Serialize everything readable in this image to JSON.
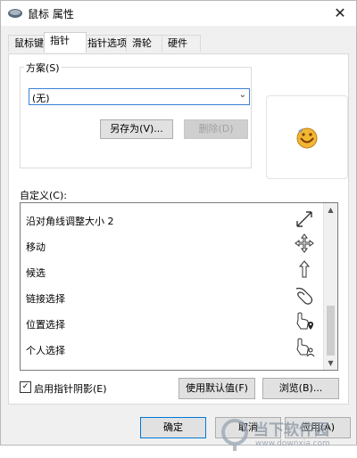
{
  "window": {
    "title": "鼠标 属性",
    "close_glyph": "✕"
  },
  "tabs": [
    {
      "label": "鼠标键",
      "active": false
    },
    {
      "label": "指针",
      "active": true
    },
    {
      "label": "指针选项",
      "active": false
    },
    {
      "label": "滑轮",
      "active": false
    },
    {
      "label": "硬件",
      "active": false
    }
  ],
  "scheme": {
    "group_label": "方案(S)",
    "selected": "(无)",
    "save_as_label": "另存为(V)...",
    "delete_label": "删除(D)"
  },
  "custom": {
    "label": "自定义(C):",
    "items": [
      {
        "label": "沿对角线调整大小 2",
        "icon": "diagonal-resize-icon"
      },
      {
        "label": "移动",
        "icon": "move-icon"
      },
      {
        "label": "候选",
        "icon": "alternate-select-icon"
      },
      {
        "label": "链接选择",
        "icon": "link-select-icon"
      },
      {
        "label": "位置选择",
        "icon": "location-select-icon"
      },
      {
        "label": "个人选择",
        "icon": "person-select-icon"
      }
    ]
  },
  "shadow_checkbox": {
    "label": "启用指针阴影(E)",
    "checked": true
  },
  "use_default_label": "使用默认值(F)",
  "browse_label": "浏览(B)...",
  "footer": {
    "ok_label": "确定",
    "cancel_label": "取消",
    "apply_label": "应用(A)"
  },
  "watermark": {
    "text": "当下软件园",
    "url": "www.downxia.com"
  },
  "colors": {
    "accent": "#0078d7",
    "select_border": "#3c7fd6",
    "panel_bg": "#f0f0f0"
  }
}
